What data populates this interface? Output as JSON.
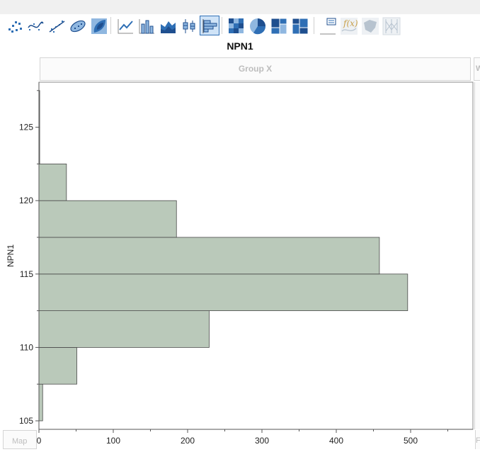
{
  "chart_title": "NPN1",
  "drop_zones": {
    "group_x": "Group X",
    "wrap": "W",
    "map": "Map",
    "freq": "F"
  },
  "toolbar": {
    "buttons": [
      {
        "name": "points-icon",
        "active": false,
        "disabled": false
      },
      {
        "name": "smoother-icon",
        "active": false,
        "disabled": false
      },
      {
        "name": "line-of-fit-icon",
        "active": false,
        "disabled": false
      },
      {
        "name": "ellipse-icon",
        "active": false,
        "disabled": false
      },
      {
        "name": "contour-icon",
        "active": false,
        "disabled": false
      },
      {
        "name": "line-icon",
        "active": false,
        "disabled": false
      },
      {
        "name": "bar-icon",
        "active": false,
        "disabled": false
      },
      {
        "name": "area-icon",
        "active": false,
        "disabled": false
      },
      {
        "name": "box-plot-icon",
        "active": false,
        "disabled": false
      },
      {
        "name": "histogram-icon",
        "active": true,
        "disabled": false
      },
      {
        "name": "heatmap-icon",
        "active": false,
        "disabled": false
      },
      {
        "name": "pie-icon",
        "active": false,
        "disabled": false
      },
      {
        "name": "treemap-icon",
        "active": false,
        "disabled": false
      },
      {
        "name": "mosaic-icon",
        "active": false,
        "disabled": false
      },
      {
        "name": "caption-box-icon",
        "active": false,
        "disabled": false
      },
      {
        "name": "formula-icon",
        "active": false,
        "disabled": true
      },
      {
        "name": "map-shapes-icon",
        "active": false,
        "disabled": true
      },
      {
        "name": "parallel-icon",
        "active": false,
        "disabled": true
      }
    ]
  },
  "colors": {
    "bar_fill": "#bac9ba",
    "bar_stroke": "#4a4a4a",
    "accent": "#2f6fb5"
  },
  "chart_data": {
    "type": "bar",
    "orientation": "horizontal",
    "title": "NPN1",
    "ylabel": "NPN1",
    "xlabel": "",
    "bins": [
      {
        "from": 105,
        "to": 107.5,
        "count": 5
      },
      {
        "from": 107.5,
        "to": 110,
        "count": 51
      },
      {
        "from": 110,
        "to": 112.5,
        "count": 229
      },
      {
        "from": 112.5,
        "to": 115,
        "count": 496
      },
      {
        "from": 115,
        "to": 117.5,
        "count": 458
      },
      {
        "from": 117.5,
        "to": 120,
        "count": 185
      },
      {
        "from": 120,
        "to": 122.5,
        "count": 37
      },
      {
        "from": 122.5,
        "to": 125,
        "count": 1
      },
      {
        "from": 125,
        "to": 127.5,
        "count": 1
      }
    ],
    "xlim": [
      0,
      583
    ],
    "ylim": [
      104.8,
      128
    ],
    "x_ticks": [
      0,
      100,
      200,
      300,
      400,
      500
    ],
    "y_ticks": [
      105,
      110,
      115,
      120,
      125
    ],
    "grid": false
  }
}
